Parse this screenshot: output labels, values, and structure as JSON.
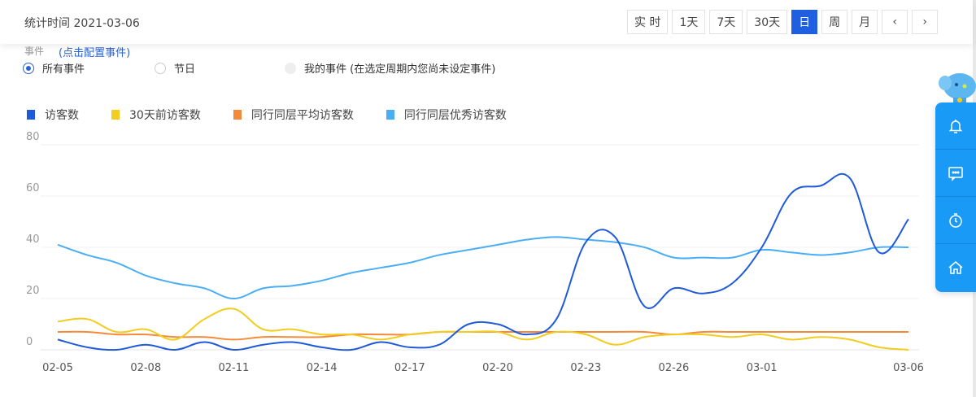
{
  "header": {
    "stat_time": "统计时间 2021-03-06",
    "buttons": [
      "实 时",
      "1天",
      "7天",
      "30天",
      "日",
      "周",
      "月",
      "‹",
      "›"
    ],
    "active": "日"
  },
  "events": {
    "label": "事件",
    "config_link": "(点击配置事件)",
    "options": [
      "所有事件",
      "节日",
      "我的事件 (在选定周期内您尚未设定事件)"
    ],
    "selected": "所有事件"
  },
  "chart_data": {
    "type": "line",
    "x": [
      "02-05",
      "02-06",
      "02-07",
      "02-08",
      "02-09",
      "02-10",
      "02-11",
      "02-12",
      "02-13",
      "02-14",
      "02-15",
      "02-16",
      "02-17",
      "02-18",
      "02-19",
      "02-20",
      "02-21",
      "02-22",
      "02-23",
      "02-24",
      "02-25",
      "02-26",
      "02-27",
      "02-28",
      "03-01",
      "03-02",
      "03-03",
      "03-04",
      "03-05",
      "03-06"
    ],
    "xticks": [
      "02-05",
      "02-08",
      "02-11",
      "02-14",
      "02-17",
      "02-20",
      "02-23",
      "02-26",
      "03-01",
      "03-06"
    ],
    "yticks": [
      "0",
      "20",
      "40",
      "60",
      "80"
    ],
    "ylim": [
      0,
      80
    ],
    "series": [
      {
        "name": "访客数",
        "color": "#1f5ad8",
        "values": [
          4,
          1,
          0,
          2,
          0,
          3,
          0,
          2,
          3,
          1,
          0,
          3,
          1,
          2,
          10,
          10,
          6,
          12,
          42,
          44,
          17,
          24,
          22,
          26,
          40,
          61,
          64,
          67,
          38,
          51
        ]
      },
      {
        "name": "30天前访客数",
        "color": "#f2cc1f",
        "values": [
          11,
          12,
          7,
          8,
          4,
          12,
          16,
          8,
          8,
          6,
          6,
          4,
          6,
          7,
          7,
          7,
          4,
          7,
          6,
          2,
          5,
          6,
          6,
          5,
          6,
          4,
          5,
          4,
          1,
          0
        ]
      },
      {
        "name": "同行同层平均访客数",
        "color": "#f5893a",
        "values": [
          7,
          7,
          6,
          6,
          5,
          5,
          4,
          5,
          5,
          5,
          6,
          6,
          6,
          7,
          7,
          7,
          7,
          7,
          7,
          7,
          7,
          6,
          7,
          7,
          7,
          7,
          7,
          7,
          7,
          7
        ]
      },
      {
        "name": "同行同层优秀访客数",
        "color": "#4aaef5",
        "values": [
          41,
          37,
          34,
          29,
          26,
          24,
          20,
          24,
          25,
          27,
          30,
          32,
          34,
          37,
          39,
          41,
          43,
          44,
          43,
          42,
          40,
          36,
          36,
          36,
          39,
          38,
          37,
          38,
          40,
          40
        ]
      }
    ]
  }
}
